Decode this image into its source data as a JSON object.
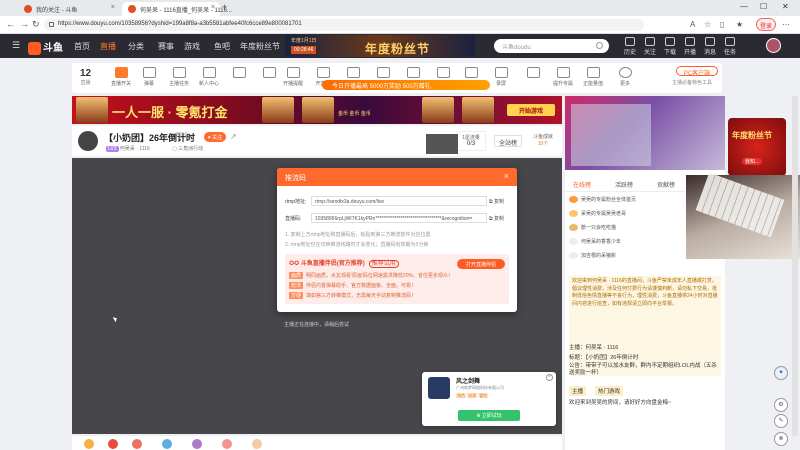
{
  "browser": {
    "tabs": [
      {
        "title": "我的关注 - 斗鱼"
      },
      {
        "title": "何吴呆 - 1116直播_何吴呆 - 1116..."
      }
    ],
    "url": "https://www.douyu.com/10358956?dyshid=199a8f8a-a3b5581abfee40fc6cce89e800081701",
    "login_label": "登录"
  },
  "site": {
    "logo_text": "斗鱼",
    "nav": [
      "首页",
      "直播",
      "分类",
      "赛事",
      "游戏",
      "鱼吧",
      "年度粉丝节"
    ],
    "banner": {
      "date_text": "年度1月1日",
      "countdown": "00:28:46",
      "headline": "年度粉丝节"
    },
    "search_placeholder": "斗鱼doudu",
    "header_icons": [
      "历史",
      "关注",
      "下载",
      "开播",
      "消息",
      "任务"
    ]
  },
  "toolbar": {
    "level_value": "12",
    "level_label": "直播",
    "tools": [
      "直播开关",
      "弹幕",
      "主播任务",
      "",
      "",
      "新人中心",
      "开播提醒",
      "开直播",
      "分享",
      "",
      "",
      "",
      "截图",
      "录屏",
      "",
      "提升专属",
      "正能量值",
      "更多"
    ],
    "gift_banner": "今日开播最高 5000万奖励 500万赠礼",
    "pc_button": "PC客户端",
    "pc_sub": "主播必备特色工具"
  },
  "ad": {
    "slogan": "一人一服 · 零氪打金",
    "promo": "金币 金币 金币",
    "start_button": "开始游戏"
  },
  "stream": {
    "title": "【小奶团】26年倒计时",
    "report": "2956",
    "follow_label": "关注",
    "meta_level": "LV3",
    "streamer": "何吴呆 · 1116",
    "category": "三角洲行动",
    "rank_label": "1星流量",
    "rank_value": "0/3",
    "all_rank": "全站榜",
    "level_label": "斗鱼成就",
    "level_value": "10个"
  },
  "modal": {
    "title": "推流码",
    "rtmp_label": "rtmp地址:",
    "rtmp_value": "rtmp://sendtx3a.douyu.com/live",
    "stream_label": "直播码:",
    "stream_value": "10358956rpLjWI7K1kyPRn**********************************&recognition=",
    "copy_label": "复制",
    "hint1": "1. 复制上方rtmp地址和直播码后，粘贴到第三方推流软件对应位置",
    "hint2": "2. rtmp地址仅在切换推流线路时才会变化；直播码有效期为5分钟",
    "promo_title": "斗鱼直播伴侣(官方推荐)",
    "promo_tag": "推荐试用",
    "open_button": "打开直播伴侣",
    "lines": [
      {
        "tag": "画质",
        "text": "明同画质，水友观看'原画'码位网速需求降低20%，省住更多观众！"
      },
      {
        "tag": "玩法",
        "text": "伴侣内置弹幕助手、官方数据面板、全面，可靠！"
      },
      {
        "tag": "方便",
        "text": "填如第三方转推模式，无需每天手动复制推流码！"
      }
    ]
  },
  "video": {
    "overlay_text": "主播正在连接中，请稍后尝试"
  },
  "game_card": {
    "name": "风之剑舞",
    "company": "广州筑梦网络科技有限公司",
    "tags": [
      "角色",
      "扮演",
      "冒险"
    ],
    "download": "立即试玩"
  },
  "right_panel": {
    "tabs": [
      "在线榜",
      "活跃榜",
      "贡献榜"
    ],
    "list": [
      "吴吴的专属粉丝全体首页",
      "呆吴的专属吴吴老哥",
      "憨一只会吃吃猫",
      "何吴呆的香香少年",
      "加吉根的呆猪新"
    ],
    "chat": "欢迎来到何吴呆 · 1116的直播间，斗鱼严禁未成年人直播或打赏。倡议理性消费，涉及任何付费行为请谨慎判断，请勿私下交易，抵制低俗色情直播等不良行为，理性消费，斗鱼直播将24小时对直播间内容进行巡查，如有违规请立即向平台举报。",
    "streamer": "主播：何吴呆 · 1116",
    "topic": "标题：【小奶团】26年倒计时",
    "notice": "公告：带带子可以加水友群，群内不定期组织LOL内战（五杀送奖励一杯）",
    "host_btn": "主播",
    "host_btn2": "热门游戏",
    "welcome": "欢迎来到吴吴的房间，请好好方向盘金梅~"
  },
  "side_ad": {
    "title": "年度粉丝节",
    "subtitle": "我知..."
  }
}
